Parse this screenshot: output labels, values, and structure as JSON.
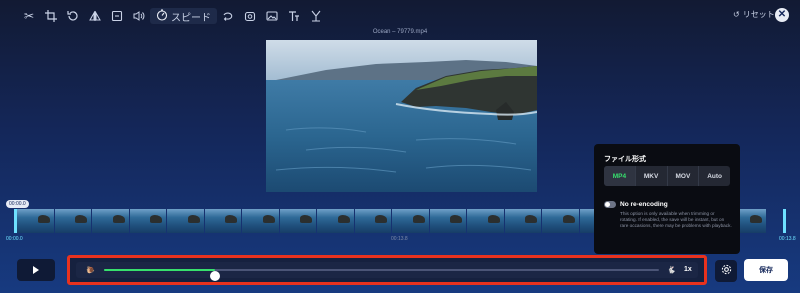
{
  "toolbar": {
    "speed_label": "スピード",
    "reset_label": "リセット",
    "icons": [
      "scissors-icon",
      "crop-icon",
      "rotate-icon",
      "flip-icon",
      "trim-box-icon",
      "volume-icon",
      "speed-icon",
      "loop-icon",
      "filter-icon",
      "image-icon",
      "text-icon",
      "watermark-icon"
    ]
  },
  "filename": "Ocean – 79779.mp4",
  "timeline": {
    "bubble_time": "00:00.0",
    "start_time": "00:00.0",
    "mid_time": "00:13.8",
    "end_time": "00:13.8",
    "frame_count": 20
  },
  "speed_control": {
    "value_label": "1x",
    "level_fraction": 0.2
  },
  "save_label": "保存",
  "format_popover": {
    "title": "ファイル形式",
    "formats": [
      "MP4",
      "MKV",
      "MOV",
      "Auto"
    ],
    "selected": "MP4",
    "reencoding_label": "No re-encoding",
    "reencoding_enabled": false,
    "reencoding_description": "This option is only available when trimming or rotating. If enabled, the save will be instant, but on rare occasions, there may be problems with playback."
  },
  "colors": {
    "accent": "#37e06d",
    "highlight_border": "#e8321e",
    "timeline_handle": "#6ee0ff"
  }
}
